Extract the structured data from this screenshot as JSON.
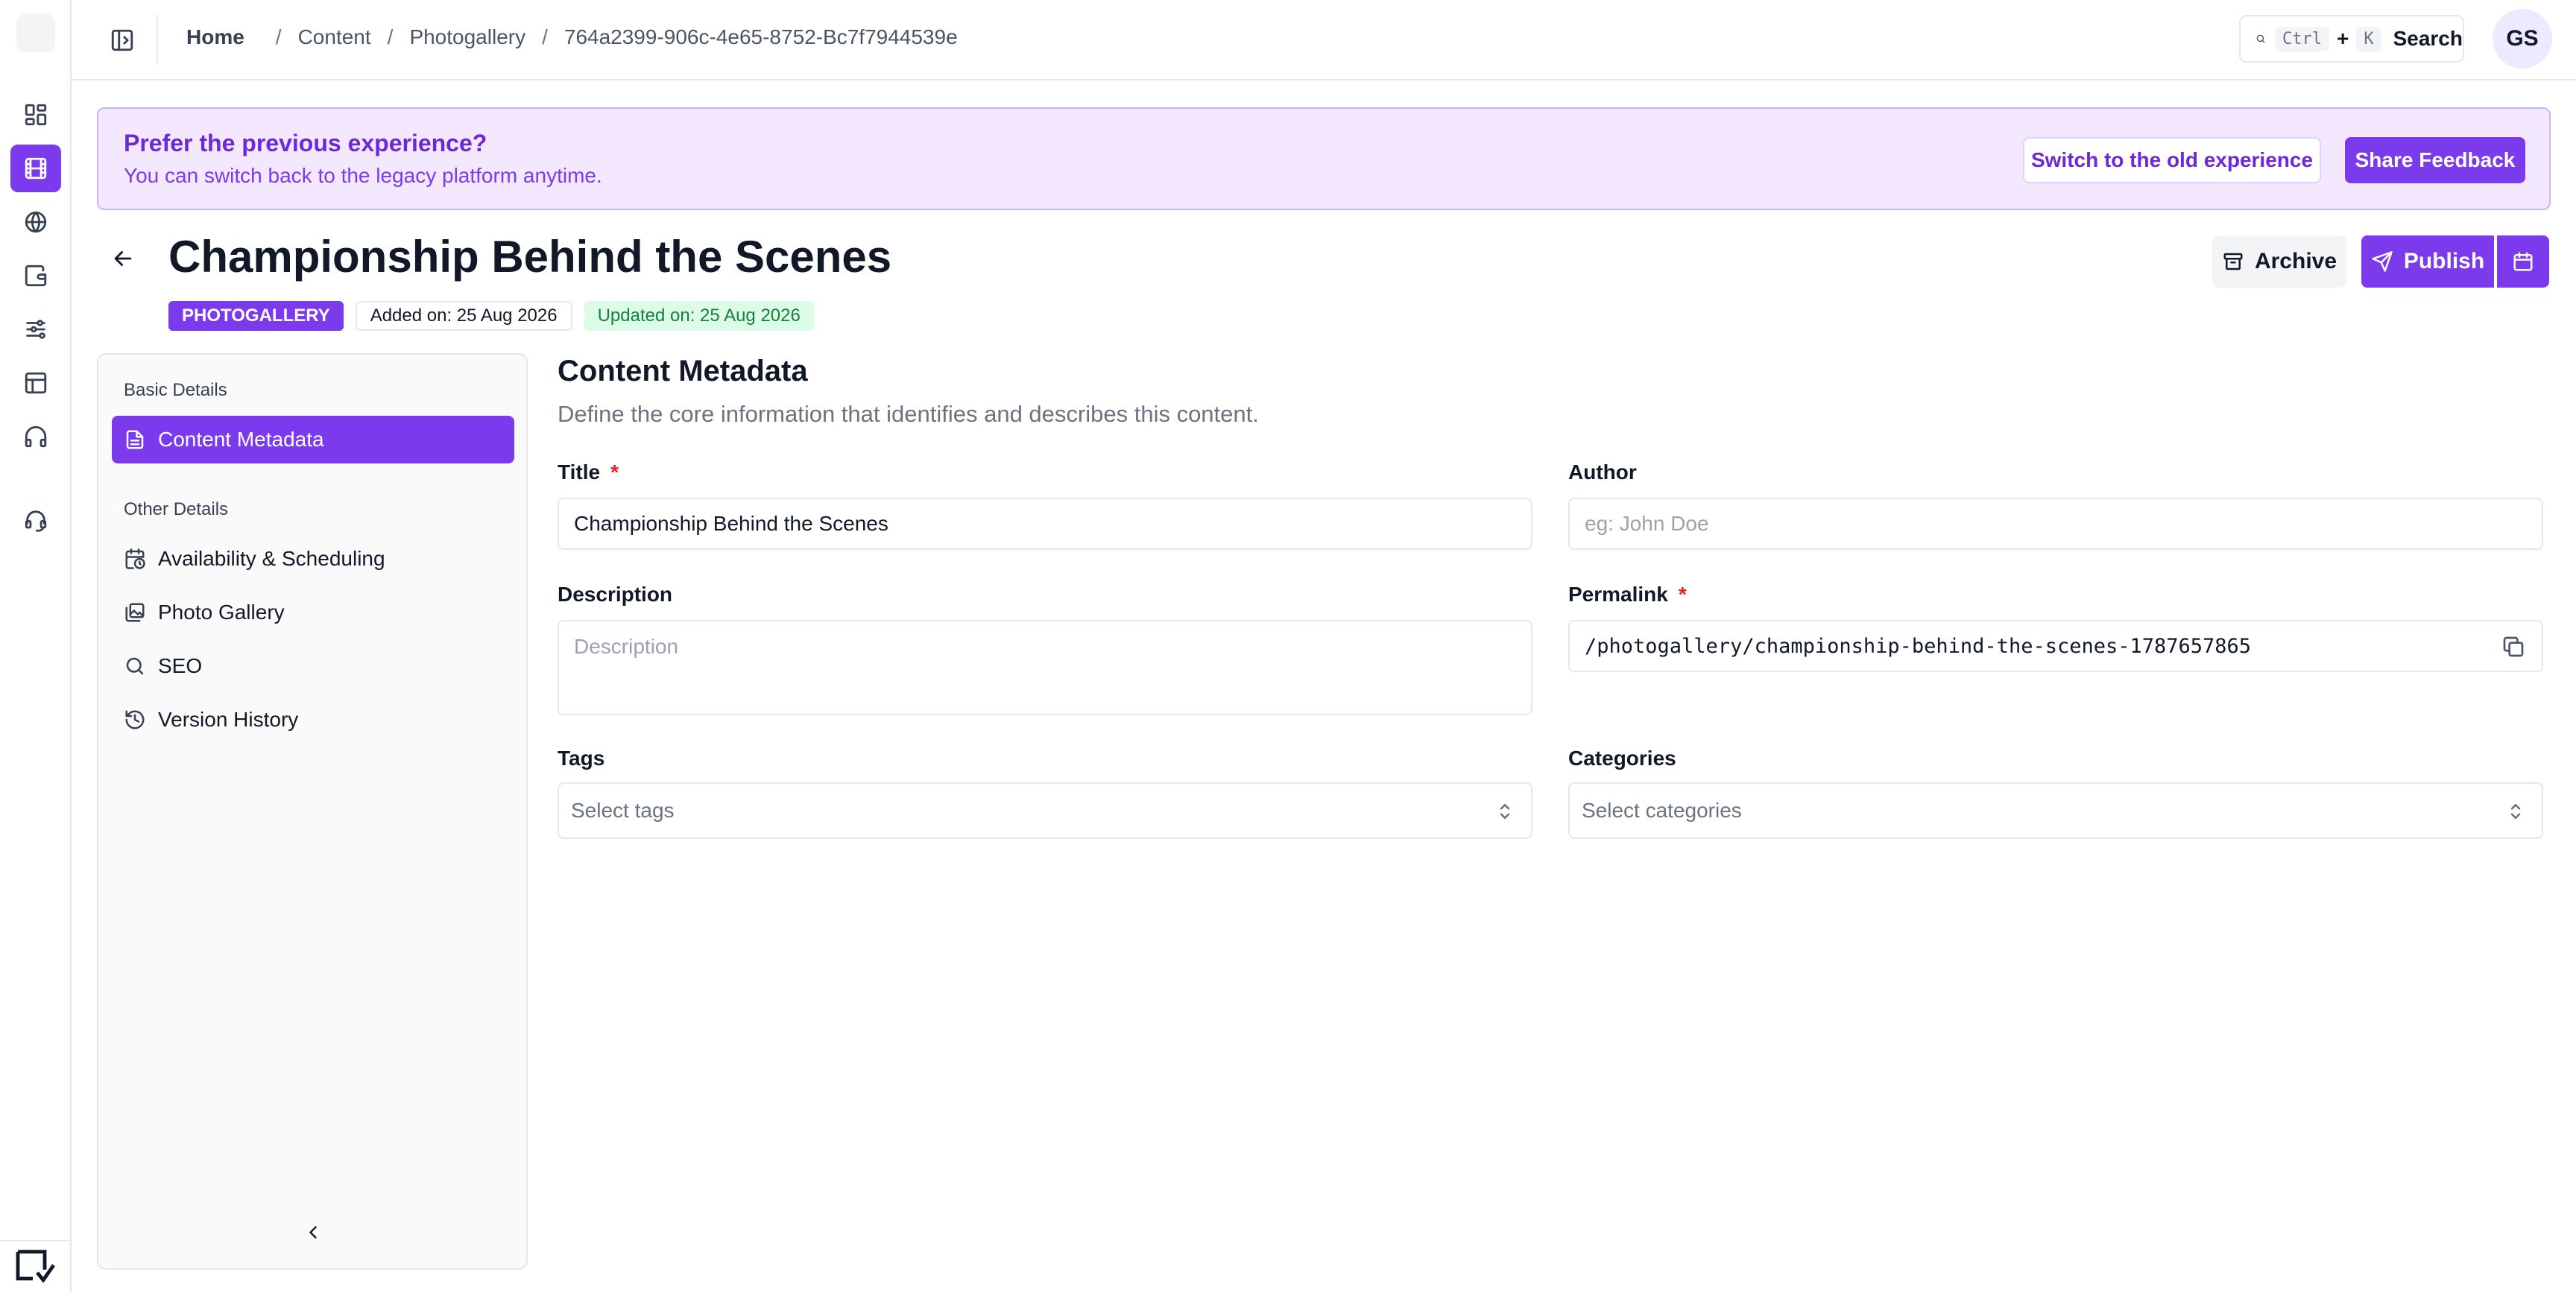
{
  "topbar": {
    "breadcrumb": {
      "home": "Home",
      "items": [
        "Content",
        "Photogallery",
        "764a2399-906c-4e65-8752-Bc7f7944539e"
      ],
      "separator": "/"
    },
    "search": {
      "key1": "Ctrl",
      "plus": "+",
      "key2": "K",
      "label": "Search"
    },
    "avatar_initials": "GS"
  },
  "banner": {
    "title": "Prefer the previous experience?",
    "subtitle": "You can switch back to the legacy platform anytime.",
    "old_experience_label": "Switch to the old experience",
    "feedback_label": "Share Feedback"
  },
  "header": {
    "title": "Championship Behind the Scenes",
    "type_badge": "PHOTOGALLERY",
    "added": "Added on: 25 Aug 2026",
    "updated": "Updated on: 25 Aug 2026",
    "archive_label": "Archive",
    "publish_label": "Publish"
  },
  "sidebar": {
    "basic_label": "Basic Details",
    "basic_items": [
      {
        "label": "Content Metadata",
        "icon": "document-icon"
      }
    ],
    "other_label": "Other Details",
    "other_items": [
      {
        "label": "Availability & Scheduling",
        "icon": "calendar-clock-icon"
      },
      {
        "label": "Photo Gallery",
        "icon": "images-icon"
      },
      {
        "label": "SEO",
        "icon": "search-icon"
      },
      {
        "label": "Version History",
        "icon": "history-icon"
      }
    ]
  },
  "form": {
    "title": "Content Metadata",
    "subtitle": "Define the core information that identifies and describes this content.",
    "title_field": {
      "label": "Title",
      "required": "*",
      "value": "Championship Behind the Scenes"
    },
    "author_field": {
      "label": "Author",
      "placeholder": "eg: John Doe"
    },
    "description_field": {
      "label": "Description",
      "placeholder": "Description"
    },
    "permalink_field": {
      "label": "Permalink",
      "required": "*",
      "value": "/photogallery/championship-behind-the-scenes-1787657865"
    },
    "tags_field": {
      "label": "Tags",
      "placeholder": "Select tags"
    },
    "categories_field": {
      "label": "Categories",
      "placeholder": "Select categories"
    }
  },
  "colors": {
    "accent": "#7c3aed",
    "banner_bg": "#f3e8ff",
    "updated_bg": "#dcfce7",
    "required": "#dc2626"
  }
}
